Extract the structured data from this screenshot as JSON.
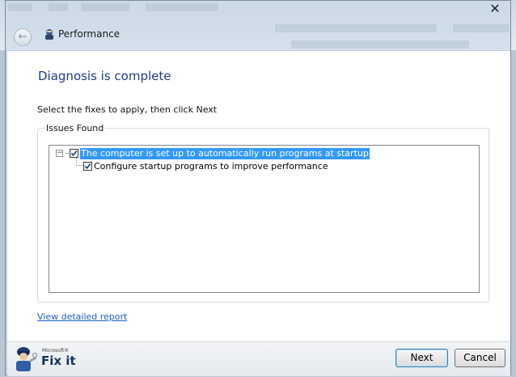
{
  "window": {
    "title": "Performance",
    "close_symbol": "✕"
  },
  "content": {
    "heading": "Diagnosis is complete",
    "instruction": "Select the fixes to apply, then click Next",
    "group_label": "Issues Found",
    "issues": [
      {
        "label": "The computer is set up to automatically run programs at startup",
        "checked": true,
        "selected": true,
        "expanded": true,
        "children": [
          {
            "label": "Configure startup programs to improve performance",
            "checked": true
          }
        ]
      }
    ],
    "report_link": "View detailed report"
  },
  "footer": {
    "logo_brand": "Microsoft®",
    "logo_name": "Fix it",
    "next_label": "Next",
    "cancel_label": "Cancel"
  },
  "colors": {
    "heading": "#1f3d8a",
    "selection": "#3399ff",
    "link": "#1f5fbf"
  },
  "icons": [
    "close-icon",
    "back-arrow-icon",
    "performance-app-icon",
    "checkbox-checked-icon",
    "tree-collapse-icon",
    "fixit-mascot-icon"
  ]
}
